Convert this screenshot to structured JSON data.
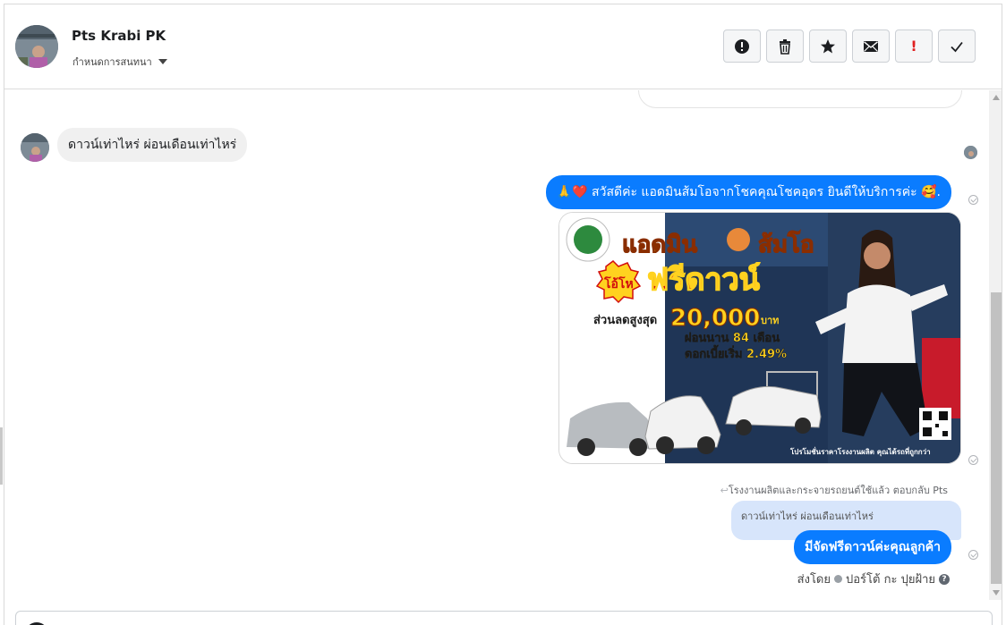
{
  "header": {
    "contact_name": "Pts Krabi PK",
    "conversation_settings_label": "กำหนดการสนทนา",
    "toolbar": [
      {
        "name": "report",
        "icon": "alert-circle-icon"
      },
      {
        "name": "delete",
        "icon": "trash-icon"
      },
      {
        "name": "star",
        "icon": "star-icon"
      },
      {
        "name": "mark-unread",
        "icon": "envelope-icon"
      },
      {
        "name": "important",
        "icon": "exclamation-icon",
        "label": "!"
      },
      {
        "name": "done",
        "icon": "check-icon"
      }
    ]
  },
  "messages": {
    "incoming_1": "ดาวน์เท่าไหร่ ผ่อนเดือนเท่าไหร่",
    "outgoing_greeting": "🙏❤️ สวัสดีค่ะ แอดมินส้มโอจากโชคคุณโชคอุดร ยินดีให้บริการค่ะ 🥰.",
    "promo_image": {
      "title_left": "แอดมิน",
      "title_right": "ส้มโอ",
      "badge": "โอ้โห",
      "headline": "ฟรีดาวน์",
      "discount_label": "ส่วนลดสูงสุด",
      "discount_amount": "20,000",
      "discount_unit": "บาท",
      "installment": "ผ่อนนาน 84 เดือน",
      "interest": "ดอกเบี้ยเริ่ม 2.49%",
      "footer": "โปรโมชั่นราคาโรงงานผลิต คุณได้รถที่ถูกกว่า"
    },
    "reply_note": "โรงงานผลิตและกระจายรถยนต์ใช้แล้ว ตอบกลับ Pts",
    "quoted_text": "ดาวน์เท่าไหร่ ผ่อนเดือนเท่าไหร่",
    "outgoing_reply": "มีจัดฟรีดาวน์ค่ะคุณลูกค้า",
    "sent_by_prefix": "ส่งโดย",
    "sent_by_name": "ปอร์โต้ กะ ปุยฝ้าย"
  },
  "colors": {
    "outgoing_bubble": "#0a7cff",
    "incoming_bubble": "#f0f0f0",
    "quoted_bubble": "#d7e5fb"
  }
}
